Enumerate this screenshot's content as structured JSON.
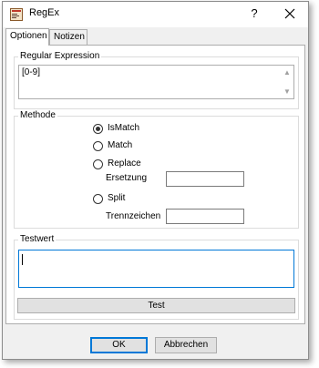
{
  "window": {
    "title": "RegEx",
    "help_glyph": "?",
    "icons": {
      "app": "app-icon",
      "help": "help-icon",
      "close": "close-icon"
    }
  },
  "tabs": [
    {
      "label": "Optionen",
      "active": true
    },
    {
      "label": "Notizen",
      "active": false
    }
  ],
  "regex_group": {
    "label": "Regular Expression",
    "value": "[0-9]",
    "scroll_up": "▲",
    "scroll_down": "▼"
  },
  "methode_group": {
    "label": "Methode",
    "options": [
      {
        "label": "IsMatch",
        "selected": true
      },
      {
        "label": "Match",
        "selected": false
      },
      {
        "label": "Replace",
        "selected": false
      },
      {
        "label": "Split",
        "selected": false
      }
    ],
    "ersetzung_label": "Ersetzung",
    "ersetzung_value": "",
    "trennzeichen_label": "Trennzeichen",
    "trennzeichen_value": ""
  },
  "testwert_group": {
    "label": "Testwert",
    "value": "",
    "test_button": "Test"
  },
  "footer": {
    "ok_label": "OK",
    "cancel_label": "Abbrechen"
  },
  "colors": {
    "focus_border": "#0078d7",
    "window_bg": "#f0f0f0"
  }
}
